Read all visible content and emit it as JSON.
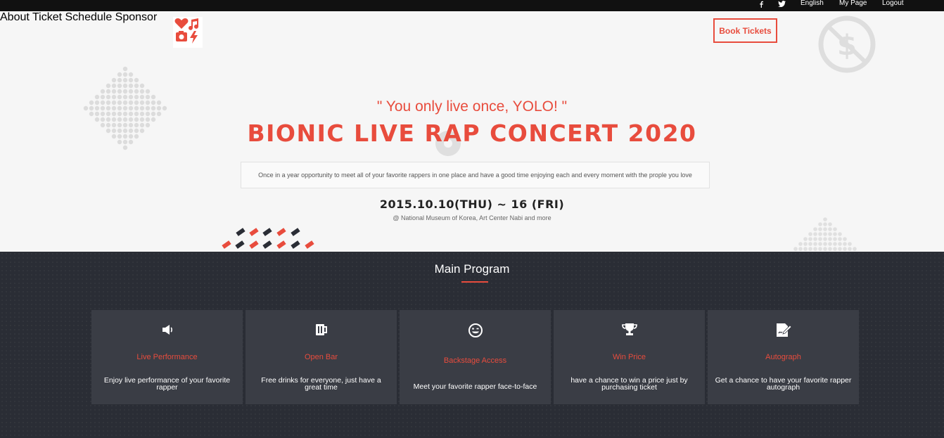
{
  "topbar": {
    "social": [
      "facebook-icon",
      "twitter-icon"
    ],
    "language": "English",
    "my_page": "My Page",
    "logout": "Logout"
  },
  "header": {
    "nav": [
      "About",
      "Ticket",
      "Schedule",
      "Sponsor"
    ],
    "book_button": "Book Tickets"
  },
  "hero": {
    "quote": "\" You only live once, YOLO! \"",
    "title": "BIONIC LIVE RAP CONCERT 2020",
    "description": "Once in a year opportunity to meet all of your favorite rappers in one place and have a good time enjoying each and every moment with the prople you love",
    "date": "2015.10.10(THU) ~ 16 (FRI)",
    "venue": "@ National Museum of Korea, Art Center Nabi and more"
  },
  "program": {
    "title": "Main Program",
    "cards": [
      {
        "icon": "speaker-icon",
        "title": "Live Performance",
        "text": "Enjoy live performance of your favorite rapper"
      },
      {
        "icon": "beer-mug-icon",
        "title": "Open Bar",
        "text": "Free drinks for everyone, just have a great time"
      },
      {
        "icon": "smile-icon",
        "title": "Backstage Access",
        "text": "Meet your favorite rapper face-to-face"
      },
      {
        "icon": "trophy-icon",
        "title": "Win Price",
        "text": "have a chance to win a price just by purchasing ticket"
      },
      {
        "icon": "signature-icon",
        "title": "Autograph",
        "text": "Get a chance to have your favorite rapper autograph"
      }
    ]
  },
  "colors": {
    "accent": "#e84c3d",
    "dark": "#2a2d35",
    "card": "#3a3d45",
    "topbar": "#111111"
  }
}
